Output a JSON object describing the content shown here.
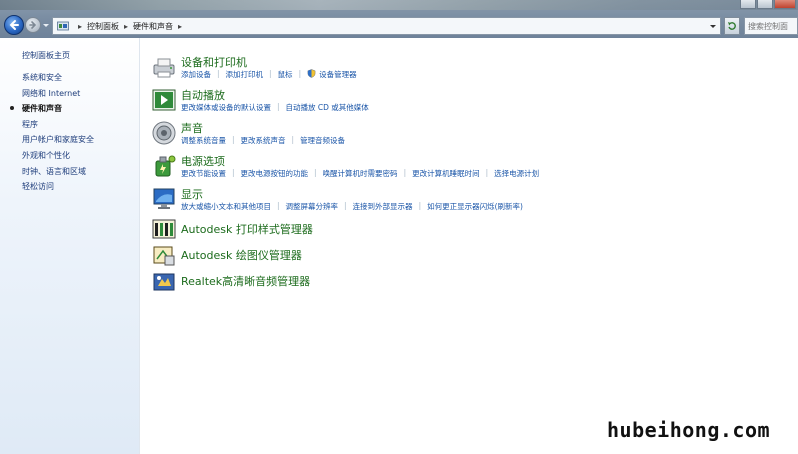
{
  "address_bar": {
    "breadcrumbs": [
      "控制面板",
      "硬件和声音"
    ]
  },
  "search": {
    "placeholder": "搜索控制面板"
  },
  "left_pane": {
    "home": "控制面板主页",
    "items": [
      {
        "label": "系统和安全",
        "active": false
      },
      {
        "label": "网络和 Internet",
        "active": false
      },
      {
        "label": "硬件和声音",
        "active": true
      },
      {
        "label": "程序",
        "active": false
      },
      {
        "label": "用户帐户和家庭安全",
        "active": false
      },
      {
        "label": "外观和个性化",
        "active": false
      },
      {
        "label": "时钟、语言和区域",
        "active": false
      },
      {
        "label": "轻松访问",
        "active": false
      }
    ]
  },
  "categories": [
    {
      "title": "设备和打印机",
      "icon": "printer-icon",
      "links": [
        "添加设备",
        "添加打印机",
        "鼠标",
        "设备管理器"
      ]
    },
    {
      "title": "自动播放",
      "icon": "autoplay-icon",
      "links": [
        "更改媒体或设备的默认设置",
        "自动播放 CD 或其他媒体"
      ]
    },
    {
      "title": "声音",
      "icon": "speaker-icon",
      "links": [
        "调整系统音量",
        "更改系统声音",
        "管理音频设备"
      ]
    },
    {
      "title": "电源选项",
      "icon": "power-icon",
      "links": [
        "更改节能设置",
        "更改电源按钮的功能",
        "唤醒计算机时需要密码",
        "更改计算机睡眠时间",
        "选择电源计划"
      ]
    },
    {
      "title": "显示",
      "icon": "display-icon",
      "links": [
        "放大或缩小文本和其他项目",
        "调整屏幕分辨率",
        "连接到外部显示器",
        "如何更正显示器闪烁(刷新率)"
      ]
    },
    {
      "title": "Autodesk 打印样式管理器",
      "icon": "print-style-icon",
      "links": []
    },
    {
      "title": "Autodesk 绘图仪管理器",
      "icon": "plotter-icon",
      "links": []
    },
    {
      "title": "Realtek高清晰音频管理器",
      "icon": "realtek-audio-icon",
      "links": []
    }
  ],
  "watermark": "hubeihong.com",
  "colors": {
    "title_green": "#1c6b1c",
    "link_blue": "#1b56a8",
    "nav_blue": "#1e3d7b"
  }
}
